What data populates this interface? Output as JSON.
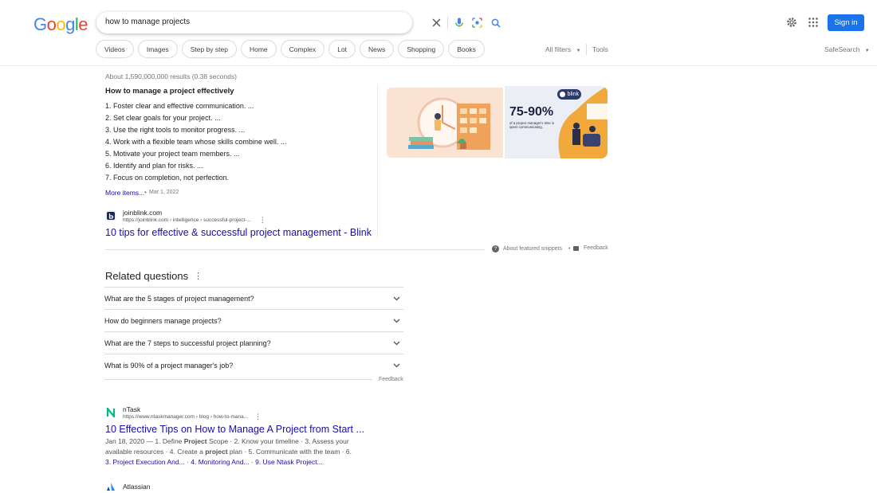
{
  "logo": {
    "letters": [
      "G",
      "o",
      "o",
      "g",
      "l",
      "e"
    ],
    "colors": [
      "#4285f4",
      "#ea4335",
      "#fbbc05",
      "#4285f4",
      "#34a853",
      "#ea4335"
    ]
  },
  "search": {
    "query": "how to manage projects"
  },
  "header": {
    "signin_label": "Sign in",
    "icons": [
      "settings-gear-icon",
      "apps-grid-icon"
    ]
  },
  "chips": [
    "Videos",
    "Images",
    "Step by step",
    "Home",
    "Complex",
    "Lot",
    "News",
    "Shopping",
    "Books"
  ],
  "filters": {
    "all_filters": "All filters",
    "tools": "Tools",
    "safesearch": "SafeSearch"
  },
  "stats": "About 1,590,000,000 results (0.38 seconds)",
  "snippet": {
    "title": "How to manage a project effectively",
    "items": [
      "1. Foster clear and effective communication. ...",
      "2. Set clear goals for your project. ...",
      "3. Use the right tools to monitor progress. ...",
      "4. Work with a flexible team whose skills combine well. ...",
      "5. Motivate your project team members. ...",
      "6. Identify and plan for risks. ...",
      "7. Focus on completion, not perfection."
    ],
    "more_items": "More items...",
    "date": "Mar 1, 2022",
    "source_name": "joinblink.com",
    "source_url": "https://joinblink.com › intelligence › successful-project-...",
    "result_title": "10 tips for effective & successful project management - Blink",
    "about": "About featured snippets",
    "feedback": "Feedback",
    "image2": {
      "brand": "blink",
      "stat": "75-90%",
      "caption": "of a project manager's time is spent communicating."
    }
  },
  "related": {
    "title": "Related questions",
    "questions": [
      "What are the 5 stages of project management?",
      "How do beginners manage projects?",
      "What are the 7 steps to successful project planning?",
      "What is 90% of a project manager's job?"
    ],
    "feedback": "Feedback"
  },
  "results": [
    {
      "name": "nTask",
      "url": "https://www.ntaskmanager.com › blog › how-to-mana...",
      "title": "10 Effective Tips on How to Manage A Project from Start ...",
      "date": "Jan 18, 2020",
      "desc_parts": [
        " — 1. Define ",
        "Project",
        " Scope · 2. Know your timeline · 3. Assess your available resources · 4. Create a ",
        "project",
        " plan · 5. Communicate with the team · 6."
      ],
      "sitelinks": [
        "3. Project Execution And...",
        "4. Monitoring And...",
        "9. Use Ntask Project..."
      ]
    },
    {
      "name": "Atlassian"
    }
  ]
}
